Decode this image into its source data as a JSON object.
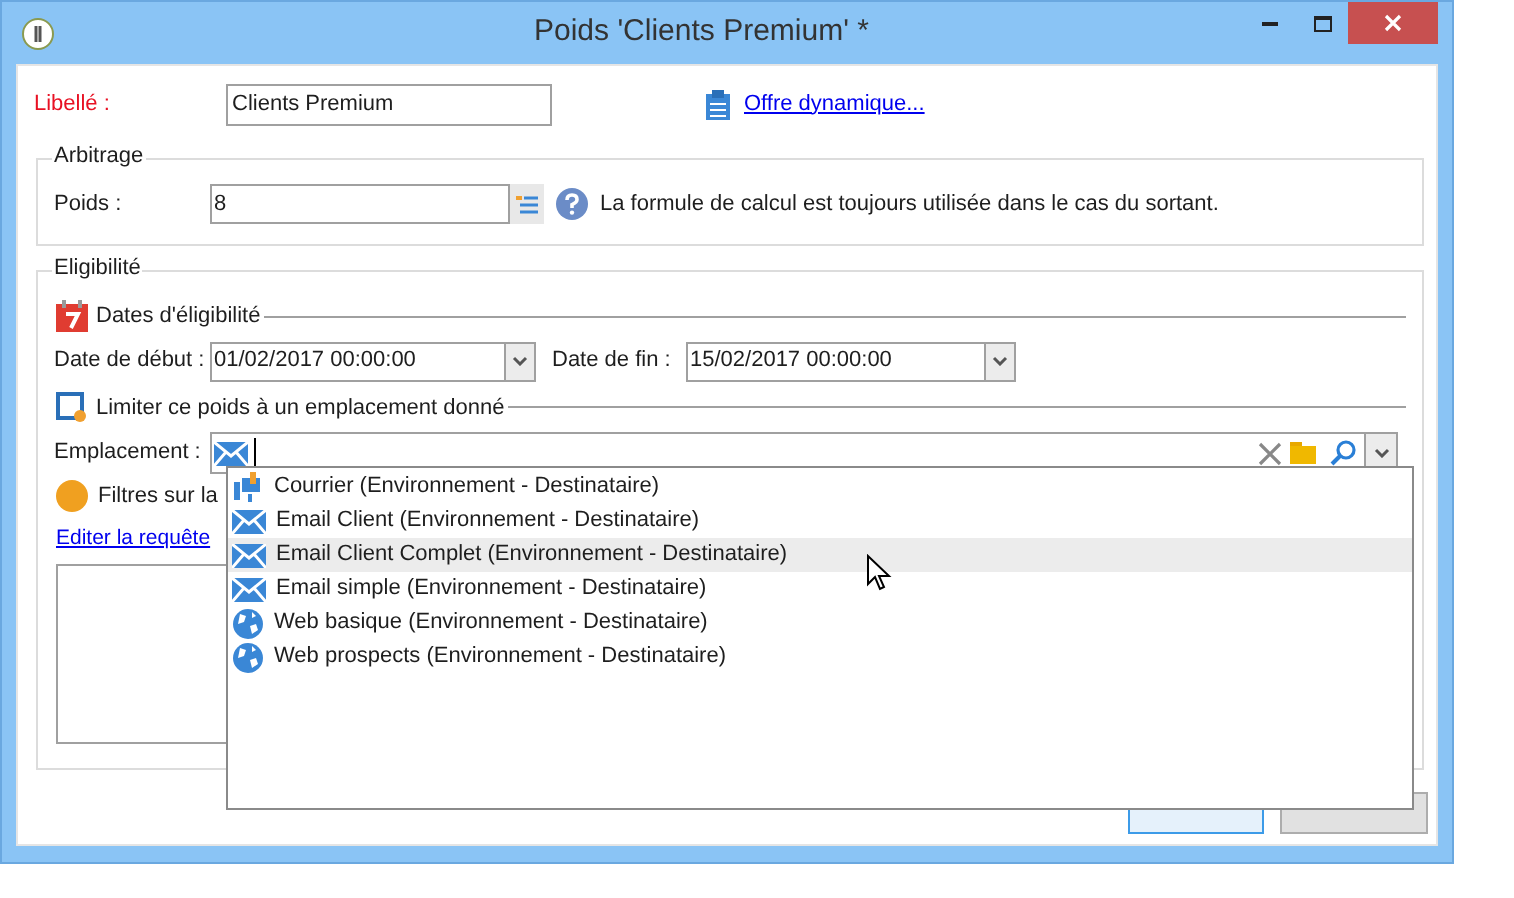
{
  "window": {
    "title": "Poids 'Clients Premium' *"
  },
  "label_field": {
    "label": "Libellé :",
    "value": "Clients Premium"
  },
  "offer_link": "Offre dynamique...",
  "arbitrage": {
    "title": "Arbitrage",
    "weight_label": "Poids :",
    "weight_value": "8",
    "help_text": "La formule de calcul est toujours utilisée dans le cas du sortant."
  },
  "eligibility": {
    "title": "Eligibilité",
    "dates_heading": "Dates d'éligibilité",
    "start_label": "Date de début :",
    "start_value": "01/02/2017 00:00:00",
    "end_label": "Date de fin :",
    "end_value": "15/02/2017 00:00:00",
    "limit_heading": "Limiter ce poids à un emplacement donné",
    "location_label": "Emplacement :",
    "filters_label": "Filtres sur la",
    "edit_link": "Editer la requête"
  },
  "location_dropdown": {
    "items": [
      {
        "kind": "post",
        "label": "Courrier (Environnement - Destinataire)",
        "selected": false
      },
      {
        "kind": "email",
        "label": "Email Client (Environnement - Destinataire)",
        "selected": false
      },
      {
        "kind": "email",
        "label": "Email Client Complet (Environnement - Destinataire)",
        "selected": true
      },
      {
        "kind": "email",
        "label": "Email simple (Environnement - Destinataire)",
        "selected": false
      },
      {
        "kind": "web",
        "label": "Web basique (Environnement - Destinataire)",
        "selected": false
      },
      {
        "kind": "web",
        "label": "Web prospects (Environnement - Destinataire)",
        "selected": false
      }
    ]
  }
}
